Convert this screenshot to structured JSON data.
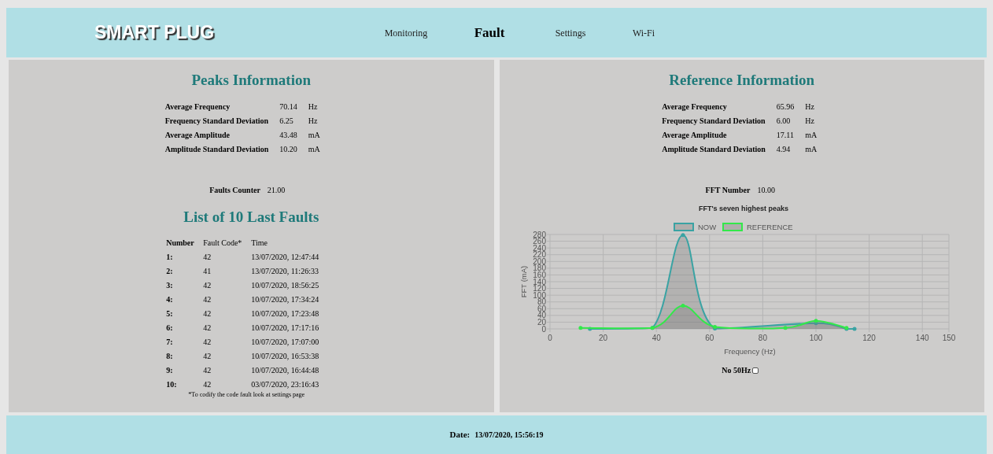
{
  "header": {
    "logo": "SMART PLUG",
    "nav": [
      {
        "label": "Monitoring",
        "selected": false
      },
      {
        "label": "Fault",
        "selected": true
      },
      {
        "label": "Settings",
        "selected": false
      },
      {
        "label": "Wi-Fi",
        "selected": false
      }
    ]
  },
  "peaks": {
    "title": "Peaks Information",
    "stats": [
      {
        "label": "Average Frequency",
        "value": "70.14",
        "unit": "Hz"
      },
      {
        "label": "Frequency Standard Deviation",
        "value": "6.25",
        "unit": "Hz"
      },
      {
        "label": "Average Amplitude",
        "value": "43.48",
        "unit": "mA"
      },
      {
        "label": "Amplitude Standard Deviation",
        "value": "10.20",
        "unit": "mA"
      }
    ],
    "counter": {
      "label": "Faults Counter",
      "value": "21.00"
    }
  },
  "faults": {
    "title": "List of 10 Last Faults",
    "columns": [
      "Number",
      "Fault Code*",
      "Time"
    ],
    "rows": [
      [
        "1:",
        "42",
        "13/07/2020, 12:47:44"
      ],
      [
        "2:",
        "41",
        "13/07/2020, 11:26:33"
      ],
      [
        "3:",
        "42",
        "10/07/2020, 18:56:25"
      ],
      [
        "4:",
        "42",
        "10/07/2020, 17:34:24"
      ],
      [
        "5:",
        "42",
        "10/07/2020, 17:23:48"
      ],
      [
        "6:",
        "42",
        "10/07/2020, 17:17:16"
      ],
      [
        "7:",
        "42",
        "10/07/2020, 17:07:00"
      ],
      [
        "8:",
        "42",
        "10/07/2020, 16:53:38"
      ],
      [
        "9:",
        "42",
        "10/07/2020, 16:44:48"
      ],
      [
        "10:",
        "42",
        "03/07/2020, 23:16:43"
      ]
    ],
    "footnote": "*To codify the code fault look at settings page"
  },
  "reference": {
    "title": "Reference Information",
    "stats": [
      {
        "label": "Average Frequency",
        "value": "65.96",
        "unit": "Hz"
      },
      {
        "label": "Frequency Standard Deviation",
        "value": "6.00",
        "unit": "Hz"
      },
      {
        "label": "Average Amplitude",
        "value": "17.11",
        "unit": "mA"
      },
      {
        "label": "Amplitude Standard Deviation",
        "value": "4.94",
        "unit": "mA"
      }
    ],
    "counter": {
      "label": "FFT Number",
      "value": "10.00"
    },
    "chart_data": {
      "type": "line",
      "title": "FFT's seven highest peaks",
      "xlabel": "Frequency (Hz)",
      "ylabel": "FFT (mA)",
      "grid": true,
      "legend": true,
      "xlim": [
        0,
        150
      ],
      "ylim": [
        0,
        280
      ],
      "xticks": [
        0,
        20,
        40,
        60,
        80,
        100,
        120,
        140,
        150
      ],
      "yticks": [
        0,
        20,
        40,
        60,
        80,
        100,
        120,
        140,
        160,
        180,
        200,
        220,
        240,
        260,
        280
      ],
      "series": [
        {
          "name": "NOW",
          "color": "#3aa3a3",
          "x": [
            15,
            38.5,
            50,
            62,
            100,
            111.5,
            114.5
          ],
          "values": [
            0,
            3,
            278,
            1,
            17,
            0,
            0
          ]
        },
        {
          "name": "REFERENCE",
          "color": "#33e84a",
          "x": [
            11.5,
            38.5,
            50,
            62,
            88.5,
            100,
            111.5
          ],
          "values": [
            3,
            3,
            69,
            6,
            3,
            24,
            3
          ]
        }
      ]
    },
    "no50hz": {
      "label": "No 50Hz",
      "checked": false
    }
  },
  "footer": {
    "label": "Date:",
    "value": "13/07/2020, 15:56:19"
  }
}
